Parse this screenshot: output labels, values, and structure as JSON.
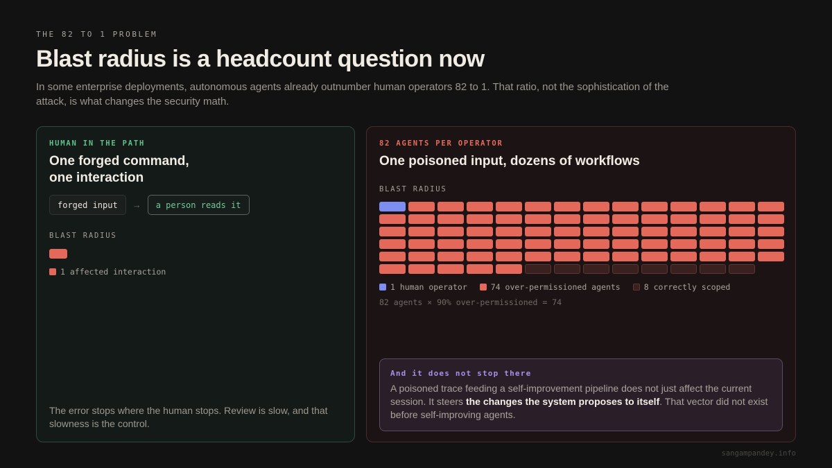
{
  "header": {
    "eyebrow": "THE 82 TO 1 PROBLEM",
    "title": "Blast radius is a headcount question now",
    "subtitle": "In some enterprise deployments, autonomous agents already outnumber human operators 82 to 1. That ratio, not the sophistication of the attack, is what changes the security math."
  },
  "left_card": {
    "kicker": "HUMAN IN THE PATH",
    "title_line1": "One forged command,",
    "title_line2": "one interaction",
    "flow": {
      "input": "forged input",
      "arrow": "→",
      "reader": "a person reads it"
    },
    "blast_label": "BLAST RADIUS",
    "affected_count": 1,
    "legend": "1 affected interaction",
    "footer": "The error stops where the human stops. Review is slow, and that slowness is the control."
  },
  "right_card": {
    "kicker": "82 AGENTS PER OPERATOR",
    "title": "One poisoned input, dozens of workflows",
    "blast_label": "BLAST RADIUS",
    "grid": {
      "human": 1,
      "over_permissioned": 74,
      "scoped": 8
    },
    "legend": {
      "human": "1 human operator",
      "over": "74 over-permissioned agents",
      "scoped": "8 correctly scoped"
    },
    "formula": "82 agents × 90% over-permissioned = 74",
    "callout": {
      "title": "And it does not stop there",
      "body_before": "A poisoned trace feeding a self-improvement pipeline does not just affect the current session. It steers ",
      "body_bold": "the changes the system proposes to itself",
      "body_after": ". That vector did not exist before self-improving agents."
    }
  },
  "colors": {
    "human": "#7c8ef2",
    "over_permissioned": "#e5695a",
    "scoped": "#3a201e",
    "left_accent": "#5fc08b",
    "right_accent": "#e46c5c",
    "callout_accent": "#a98ee8"
  },
  "footer": {
    "site": "sangampandey.info"
  }
}
